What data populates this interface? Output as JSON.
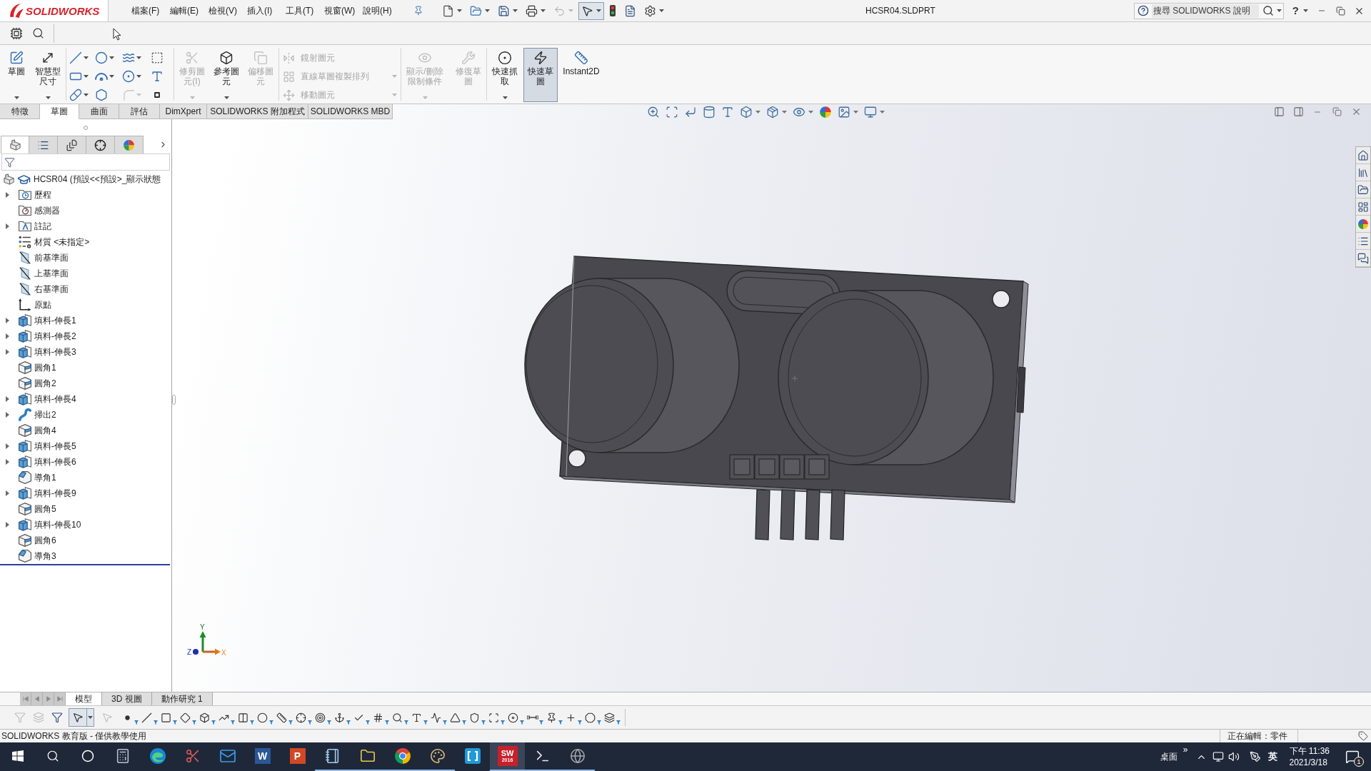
{
  "title_bar": {
    "logo": "SOLIDWORKS",
    "menu": [
      "檔案(F)",
      "編輯(E)",
      "檢視(V)",
      "插入(I)",
      "工具(T)",
      "視窗(W)",
      "說明(H)"
    ],
    "quick_access": [
      {
        "disabled": false,
        "pressed": false
      },
      {
        "disabled": false,
        "pressed": false
      },
      {
        "disabled": false,
        "pressed": false
      },
      {
        "disabled": false,
        "pressed": false
      },
      {
        "disabled": true,
        "pressed": false
      },
      {
        "disabled": false,
        "pressed": true
      },
      {
        "disabled": false,
        "pressed": false
      },
      {
        "disabled": false,
        "pressed": false
      },
      {
        "disabled": false,
        "pressed": false
      }
    ],
    "document_title": "HCSR04.SLDPRT",
    "search": {
      "placeholder": "搜尋 SOLIDWORKS 說明"
    },
    "help": "?"
  },
  "ribbon": {
    "groups": [
      {
        "kind": "large",
        "items": [
          {
            "label": "草圖",
            "disabled": false,
            "selected": false,
            "dropdown": true
          },
          {
            "label": "智慧型尺寸",
            "disabled": false,
            "selected": false,
            "dropdown": true
          }
        ]
      },
      {
        "kind": "grid",
        "items": [
          {
            "disabled": false,
            "dropdown": true
          },
          {
            "disabled": false,
            "dropdown": true
          },
          {
            "disabled": false,
            "dropdown": true
          },
          {
            "disabled": false,
            "dropdown": false
          },
          {
            "disabled": false,
            "dropdown": true
          },
          {
            "disabled": false,
            "dropdown": true
          },
          {
            "disabled": false,
            "dropdown": true
          },
          {
            "disabled": false,
            "dropdown": false
          },
          {
            "disabled": false,
            "dropdown": true
          },
          {
            "disabled": false,
            "dropdown": false
          },
          {
            "disabled": true,
            "dropdown": true
          },
          {
            "disabled": false,
            "dropdown": false
          }
        ]
      },
      {
        "kind": "large",
        "items": [
          {
            "label": "修剪圖元(I)",
            "disabled": true,
            "selected": false,
            "dropdown": true
          },
          {
            "label": "參考圖元",
            "disabled": false,
            "selected": false,
            "dropdown": true
          },
          {
            "label": "偏移圖元",
            "disabled": true,
            "selected": false,
            "dropdown": false
          }
        ]
      },
      {
        "kind": "list",
        "items": [
          {
            "label": "鏡射圖元",
            "disabled": true,
            "dropdown": false
          },
          {
            "label": "直線草圖複製排列",
            "disabled": true,
            "dropdown": true
          },
          {
            "label": "移動圖元",
            "disabled": true,
            "dropdown": true
          }
        ]
      },
      {
        "kind": "large",
        "items": [
          {
            "label": "顯示/刪除限制條件",
            "disabled": true,
            "selected": false,
            "dropdown": true
          },
          {
            "label": "修復草圖",
            "disabled": true,
            "selected": false,
            "dropdown": false
          }
        ]
      },
      {
        "kind": "large",
        "items": [
          {
            "label": "快速抓取",
            "disabled": false,
            "selected": false,
            "dropdown": true
          },
          {
            "label": "快速草圖",
            "disabled": false,
            "selected": true,
            "dropdown": false
          },
          {
            "label": "Instant2D",
            "disabled": false,
            "selected": false,
            "dropdown": false
          }
        ]
      }
    ],
    "tabs": [
      {
        "label": "特徵",
        "selected": false
      },
      {
        "label": "草圖",
        "selected": true
      },
      {
        "label": "曲面",
        "selected": false
      },
      {
        "label": "評估",
        "selected": false
      },
      {
        "label": "DimXpert",
        "selected": false
      },
      {
        "label": "SOLIDWORKS 附加程式",
        "selected": false
      },
      {
        "label": "SOLIDWORKS MBD",
        "selected": false
      }
    ]
  },
  "panel": {
    "tabs": [
      {
        "selected": true
      },
      {
        "selected": false
      },
      {
        "selected": false
      },
      {
        "selected": false
      },
      {
        "selected": false
      }
    ],
    "root": {
      "label": "HCSR04 (預設<<預設>_顯示狀態"
    },
    "items": [
      {
        "kind": "history",
        "label": "歷程",
        "expandable": true
      },
      {
        "kind": "sensors",
        "label": "感測器",
        "expandable": false
      },
      {
        "kind": "annotations",
        "label": "註記",
        "expandable": true
      },
      {
        "kind": "material",
        "label": "材質 <未指定>",
        "expandable": false
      },
      {
        "kind": "plane",
        "label": "前基準面",
        "expandable": false
      },
      {
        "kind": "plane",
        "label": "上基準面",
        "expandable": false
      },
      {
        "kind": "plane",
        "label": "右基準面",
        "expandable": false
      },
      {
        "kind": "origin",
        "label": "原點",
        "expandable": false
      },
      {
        "kind": "extrude",
        "label": "填料-伸長1",
        "expandable": true
      },
      {
        "kind": "extrude",
        "label": "填料-伸長2",
        "expandable": true
      },
      {
        "kind": "extrude",
        "label": "填料-伸長3",
        "expandable": true
      },
      {
        "kind": "fillet",
        "label": "圓角1",
        "expandable": false
      },
      {
        "kind": "fillet",
        "label": "圓角2",
        "expandable": false
      },
      {
        "kind": "extrude",
        "label": "填料-伸長4",
        "expandable": true
      },
      {
        "kind": "sweep",
        "label": "掃出2",
        "expandable": true
      },
      {
        "kind": "fillet",
        "label": "圓角4",
        "expandable": false
      },
      {
        "kind": "extrude",
        "label": "填料-伸長5",
        "expandable": true
      },
      {
        "kind": "extrude",
        "label": "填料-伸長6",
        "expandable": true
      },
      {
        "kind": "chamfer",
        "label": "導角1",
        "expandable": false
      },
      {
        "kind": "extrude",
        "label": "填料-伸長9",
        "expandable": true
      },
      {
        "kind": "fillet",
        "label": "圓角5",
        "expandable": false
      },
      {
        "kind": "extrude",
        "label": "填料-伸長10",
        "expandable": true
      },
      {
        "kind": "fillet",
        "label": "圓角6",
        "expandable": false
      },
      {
        "kind": "chamfer",
        "label": "導角3",
        "expandable": false
      }
    ]
  },
  "viewport": {
    "triad": {
      "y": "Y",
      "z": "Z",
      "x": "X"
    }
  },
  "bottom_tabs": [
    {
      "label": "模型",
      "selected": true
    },
    {
      "label": "3D 視圖",
      "selected": false
    },
    {
      "label": "動作研究 1",
      "selected": false
    }
  ],
  "selection_filter": {
    "select_pressed": true
  },
  "status_bar": {
    "left": "SOLIDWORKS 教育版 - 僅供教學使用",
    "mode": "正在編輯：零件"
  },
  "taskbar": {
    "apps": [
      {
        "running": false,
        "active": false
      },
      {
        "running": false,
        "active": false
      },
      {
        "running": false,
        "active": false
      },
      {
        "running": false,
        "active": false
      },
      {
        "running": false,
        "active": false
      },
      {
        "running": false,
        "active": false
      },
      {
        "running": false,
        "active": false
      },
      {
        "running": false,
        "active": false,
        "glyph": "W"
      },
      {
        "running": false,
        "active": false,
        "glyph": "P"
      },
      {
        "running": true,
        "active": false
      },
      {
        "running": true,
        "active": false
      },
      {
        "running": true,
        "active": false
      },
      {
        "running": true,
        "active": false
      },
      {
        "running": false,
        "active": false
      },
      {
        "running": true,
        "active": true,
        "glyph": "SW",
        "caption": "2016"
      },
      {
        "running": true,
        "active": false
      },
      {
        "running": true,
        "active": false
      }
    ],
    "tray": {
      "desktop": "桌面",
      "overflow": "»",
      "ime": "英",
      "time": "下午 11:36",
      "date": "2021/3/18",
      "notifications": "1"
    }
  }
}
